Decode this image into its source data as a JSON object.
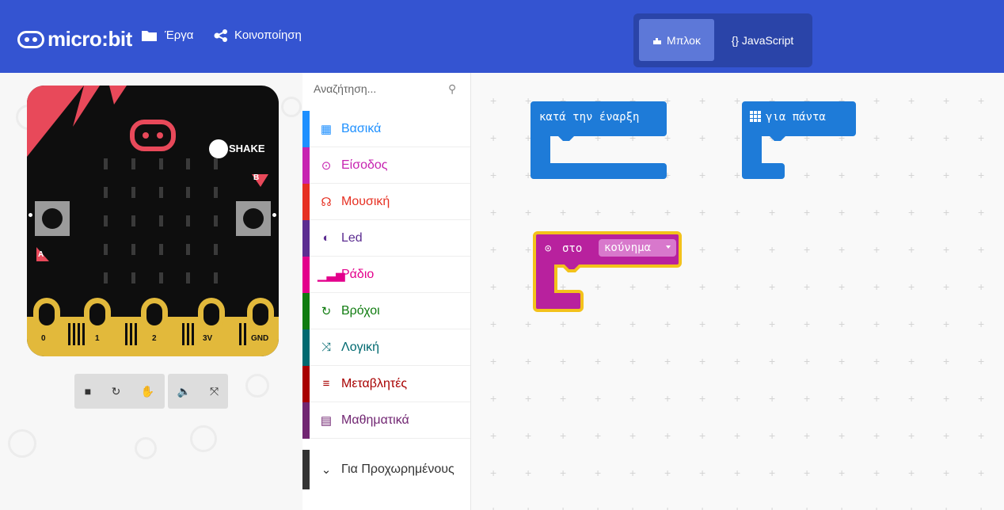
{
  "header": {
    "logo_text": "micro:bit",
    "projects_label": "Έργα",
    "share_label": "Κοινοποίηση",
    "mode_blocks_label": "Μπλοκ",
    "mode_js_label": "{} JavaScript",
    "accent_color": "#3454d1"
  },
  "simulator": {
    "shake_label": "SHAKE",
    "button_a_label": "A",
    "button_b_label": "B",
    "pins": [
      "0",
      "1",
      "2",
      "3V",
      "GND"
    ],
    "controls": [
      "stop-icon",
      "restart-icon",
      "debug-icon",
      "mute-icon",
      "fullscreen-icon"
    ]
  },
  "toolbox": {
    "search_placeholder": "Αναζήτηση...",
    "categories": [
      {
        "label": "Βασικά",
        "color": "#1e90ff",
        "icon": "grid-icon"
      },
      {
        "label": "Είσοδος",
        "color": "#c724b1",
        "icon": "target-icon"
      },
      {
        "label": "Μουσική",
        "color": "#e63022",
        "icon": "headphones-icon"
      },
      {
        "label": "Led",
        "color": "#5c2d91",
        "icon": "toggle-icon"
      },
      {
        "label": "Ράδιο",
        "color": "#e3008c",
        "icon": "signal-icon"
      },
      {
        "label": "Βρόχοι",
        "color": "#107c10",
        "icon": "loop-icon"
      },
      {
        "label": "Λογική",
        "color": "#006970",
        "icon": "shuffle-icon"
      },
      {
        "label": "Μεταβλητές",
        "color": "#a80000",
        "icon": "list-icon"
      },
      {
        "label": "Μαθηματικά",
        "color": "#712672",
        "icon": "calculator-icon"
      }
    ],
    "advanced_label": "Για Προχωρημένους"
  },
  "workspace": {
    "on_start_label": "κατά την έναρξη",
    "forever_label": "για πάντα",
    "on_event_prefix": "στο",
    "on_event_value": "κούνημα"
  }
}
